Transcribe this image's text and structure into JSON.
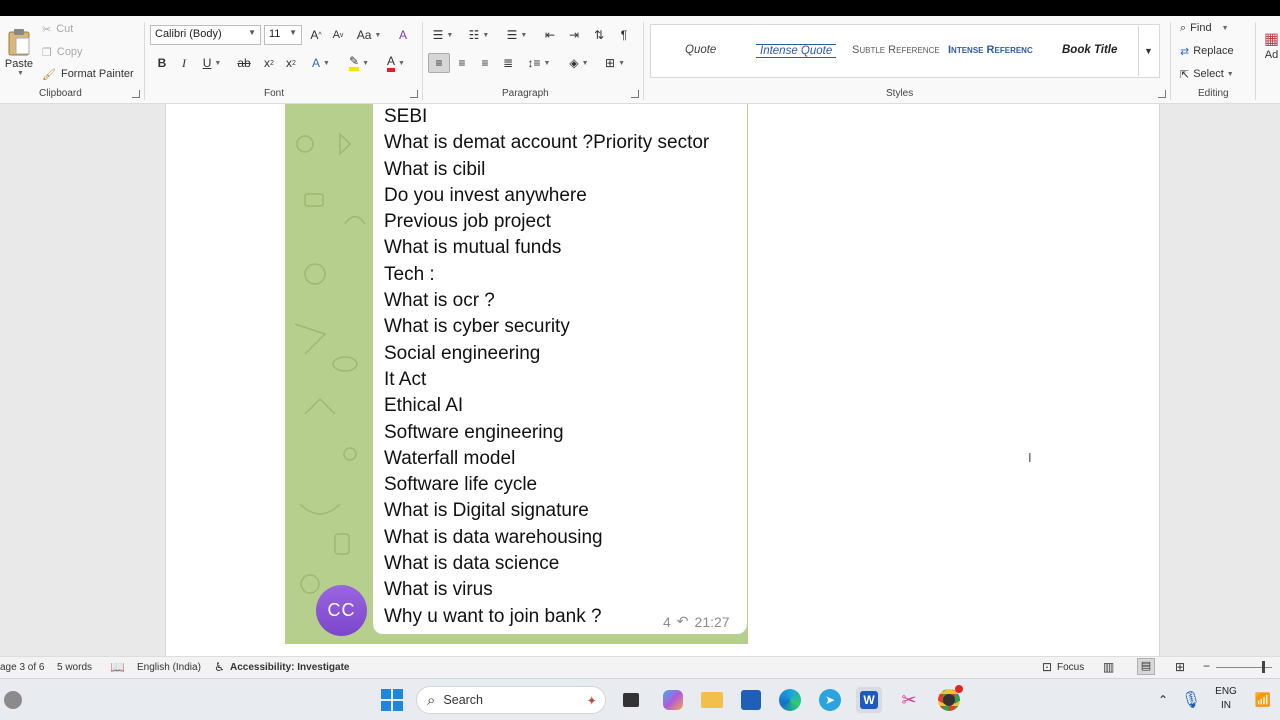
{
  "ribbon": {
    "clipboard": {
      "paste": "Paste",
      "cut": "Cut",
      "copy": "Copy",
      "format_painter": "Format Painter",
      "label": "Clipboard"
    },
    "font": {
      "name": "Calibri (Body)",
      "size": "11",
      "label": "Font"
    },
    "paragraph": {
      "label": "Paragraph"
    },
    "styles": {
      "items": [
        "Quote",
        "Intense Quote",
        "Subtle Reference",
        "Intense Referenc",
        "Book Title"
      ],
      "label": "Styles"
    },
    "editing": {
      "find": "Find",
      "replace": "Replace",
      "select": "Select",
      "label": "Editing"
    },
    "add_partial": "Ad"
  },
  "message": {
    "lines": [
      "SEBI",
      "What is demat account ?Priority sector",
      "What is cibil",
      "Do you invest anywhere",
      "Previous job project",
      "What is mutual funds",
      "Tech :",
      "What is ocr ?",
      "What is cyber security",
      "Social engineering",
      "It Act",
      "Ethical AI",
      "Software engineering",
      "Waterfall model",
      "Software life cycle",
      "What is Digital signature",
      "What is data warehousing",
      "What is data science",
      "What is virus",
      "Why u want to join bank ?"
    ],
    "avatar": "CC",
    "replies": "4",
    "time": "21:27"
  },
  "status": {
    "page": "age 3 of 6",
    "words": "5 words",
    "language": "English (India)",
    "accessibility": "Accessibility: Investigate",
    "focus": "Focus"
  },
  "taskbar": {
    "search": "Search",
    "lang_top": "ENG",
    "lang_bottom": "IN"
  },
  "colors": {
    "accent": "#2b579a",
    "bubble_green": "#b7cf8c",
    "avatar": "#8a56d8"
  }
}
